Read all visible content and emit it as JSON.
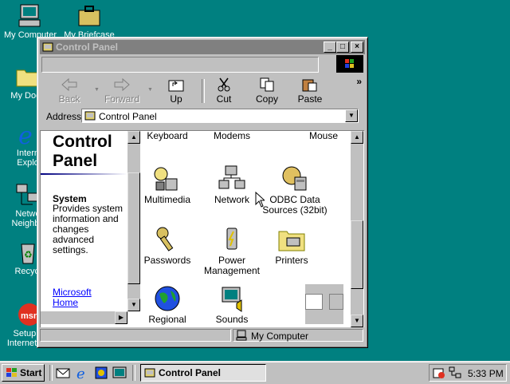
{
  "desktop": {
    "icons": [
      {
        "label": "My Computer",
        "icon": "my-computer-icon"
      },
      {
        "label": "My Briefcase",
        "icon": "briefcase-icon"
      },
      {
        "label": "My Docu",
        "icon": "folder-icon"
      },
      {
        "label": "Intern",
        "label2": "Explo",
        "icon": "internet-explorer-icon"
      },
      {
        "label": "Netwo",
        "label2": "Neighbo",
        "icon": "network-neighborhood-icon"
      },
      {
        "label": "Recycl",
        "icon": "recycle-bin-icon"
      },
      {
        "label": "Setup M",
        "label2": "Internet A...",
        "icon": "msn-icon"
      }
    ]
  },
  "window": {
    "title": "Control Panel",
    "title_buttons": [
      "_",
      "□",
      "×"
    ],
    "toolbar": {
      "back": "Back",
      "forward": "Forward",
      "up": "Up",
      "cut": "Cut",
      "copy": "Copy",
      "paste": "Paste",
      "more": "»"
    },
    "address": {
      "label": "Address",
      "value": "Control Panel"
    },
    "info": {
      "title_line1": "Control",
      "title_line2": "Panel",
      "heading": "System",
      "description": "Provides system information and changes advanced settings.",
      "link_line1": "Microsoft",
      "link_line2": "Home"
    },
    "items": [
      {
        "label": "Keyboard"
      },
      {
        "label": "Modems"
      },
      {
        "label": "Mouse"
      },
      {
        "label": "Multimedia"
      },
      {
        "label": "Network"
      },
      {
        "label": "ODBC Data",
        "label2": "Sources (32bit)"
      },
      {
        "label": "Passwords"
      },
      {
        "label": "Power",
        "label2": "Management"
      },
      {
        "label": "Printers"
      },
      {
        "label": "Regional"
      },
      {
        "label": "Sounds"
      }
    ],
    "status": {
      "location": "My Computer"
    }
  },
  "taskbar": {
    "start": "Start",
    "task": "Control Panel",
    "clock": "5:33 PM"
  },
  "colors": {
    "desktop": "#008080",
    "title_inactive": "#808080",
    "face": "#c0c0c0",
    "link": "#0000ff"
  }
}
